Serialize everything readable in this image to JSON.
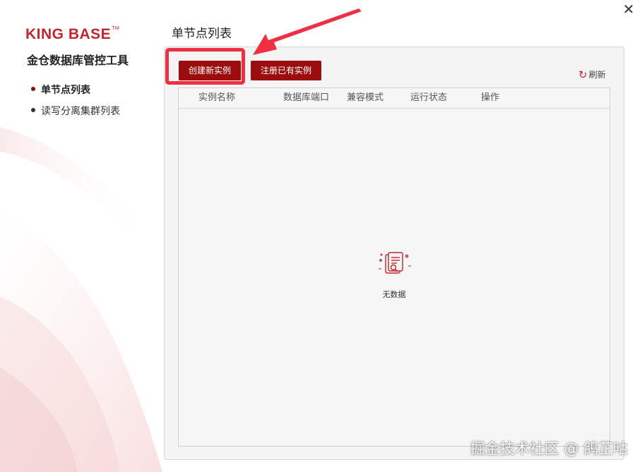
{
  "window": {
    "close_glyph": "✕"
  },
  "sidebar": {
    "logo_text": "KING BASE",
    "logo_tm": "TM",
    "app_title": "金仓数据库管控工具",
    "items": [
      {
        "label": "单节点列表",
        "active": true
      },
      {
        "label": "读写分离集群列表",
        "active": false
      }
    ]
  },
  "main": {
    "title": "单节点列表",
    "buttons": {
      "create": "创建新实例",
      "register": "注册已有实例"
    },
    "refresh_label": "刷新",
    "refresh_icon": "refresh-icon",
    "table": {
      "columns": [
        "实例名称",
        "数据库端口",
        "兼容模式",
        "运行状态",
        "操作"
      ],
      "rows": [],
      "empty_text": "无数据",
      "empty_icon": "empty-document-icon"
    }
  },
  "annotation": {
    "highlight_color": "#ee3042",
    "arrow_color": "#ee3042"
  },
  "watermark": "掘金技术社区 @ 鸽芷咕",
  "colors": {
    "brand": "#c1272d",
    "button": "#9c0d0d",
    "active_dot": "#8b0f0f"
  }
}
